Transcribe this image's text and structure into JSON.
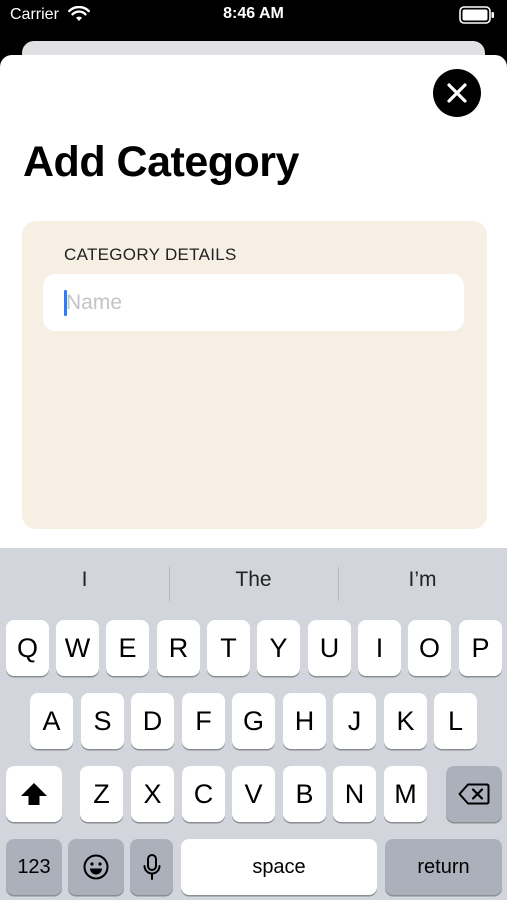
{
  "status_bar": {
    "carrier": "Carrier",
    "time": "8:46 AM"
  },
  "sheet": {
    "title": "Add Category",
    "section_header": "CATEGORY DETAILS",
    "name_field": {
      "placeholder": "Name",
      "value": ""
    }
  },
  "keyboard": {
    "suggestions": [
      "I",
      "The",
      "I’m"
    ],
    "row1": [
      "Q",
      "W",
      "E",
      "R",
      "T",
      "Y",
      "U",
      "I",
      "O",
      "P"
    ],
    "row2": [
      "A",
      "S",
      "D",
      "F",
      "G",
      "H",
      "J",
      "K",
      "L"
    ],
    "row3": [
      "Z",
      "X",
      "C",
      "V",
      "B",
      "N",
      "M"
    ],
    "numbers_key": "123",
    "space_key": "space",
    "return_key": "return"
  },
  "colors": {
    "accent": "#2f7cf6",
    "card_background": "#f7efe4",
    "keyboard_background": "#d2d5db"
  },
  "icons": {
    "close": "close-icon",
    "shift": "shift-icon",
    "delete": "delete-icon",
    "emoji": "emoji-icon",
    "microphone": "microphone-icon"
  }
}
